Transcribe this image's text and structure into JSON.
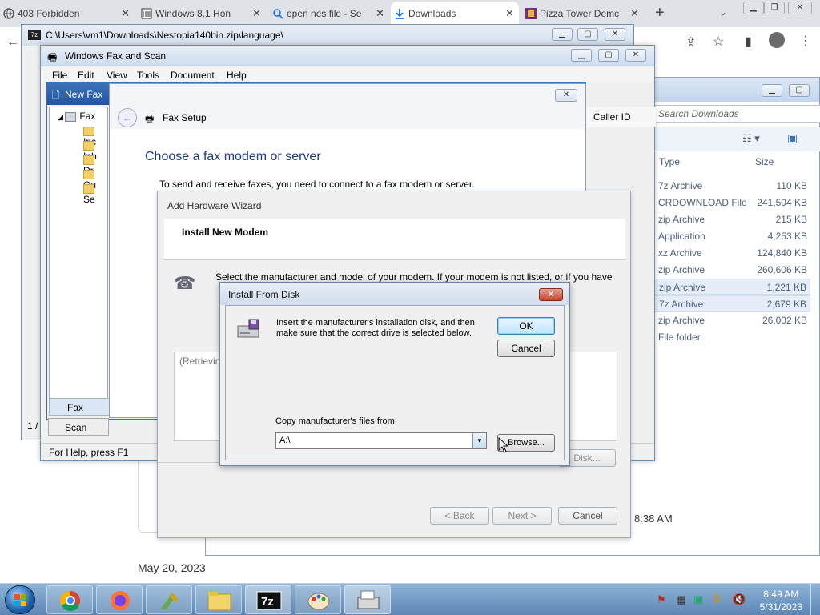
{
  "chrome": {
    "tabs": [
      {
        "label": "403 Forbidden"
      },
      {
        "label": "Windows 8.1 Hon"
      },
      {
        "label": "open nes file - Se"
      },
      {
        "label": "Downloads"
      },
      {
        "label": "Pizza Tower Demc"
      }
    ],
    "new_tab_label": "+"
  },
  "explorer": {
    "search_placeholder": "Search Downloads",
    "col_type": "Type",
    "col_size": "Size",
    "rows": [
      {
        "type": "7z Archive",
        "size": "110 KB"
      },
      {
        "type": "CRDOWNLOAD File",
        "size": "241,504 KB"
      },
      {
        "type": "zip Archive",
        "size": "215 KB"
      },
      {
        "type": "Application",
        "size": "4,253 KB"
      },
      {
        "type": "xz Archive",
        "size": "124,840 KB"
      },
      {
        "type": "zip Archive",
        "size": "260,606 KB"
      },
      {
        "type": "zip Archive",
        "size": "1,221 KB"
      },
      {
        "type": "7z Archive",
        "size": "2,679 KB"
      },
      {
        "type": "zip Archive",
        "size": "26,002 KB"
      },
      {
        "type": "File folder",
        "size": ""
      }
    ]
  },
  "background": {
    "date": "May 20, 2023",
    "time": "8:38 AM"
  },
  "win7z": {
    "title": "C:\\Users\\vm1\\Downloads\\Nestopia140bin.zip\\language\\"
  },
  "fax": {
    "title": "Windows Fax and Scan",
    "menu": [
      "File",
      "Edit",
      "View",
      "Tools",
      "Document",
      "Help"
    ],
    "nav_root": "Fax",
    "nav_children": [
      "Inc",
      "Inb",
      "Dr",
      "Ou",
      "Se"
    ],
    "bottom_tabs": [
      "Fax",
      "Scan"
    ],
    "status": "For Help, press F1",
    "caller_id": "Caller ID"
  },
  "newfax": {
    "title": "New Fax"
  },
  "setup": {
    "title": "Fax Setup",
    "heading": "Choose a fax modem or server",
    "desc": "To send and receive faxes, you need to connect to a fax modem or server."
  },
  "wizard": {
    "title": "Add Hardware Wizard",
    "header": "Install New Modem",
    "desc": "Select the manufacturer and model of your modem. If your modem is not listed, or if you have",
    "retrieving": "(Retrievin",
    "have_disk": "Disk...",
    "back": "< Back",
    "next": "Next >",
    "cancel": "Cancel"
  },
  "ifd": {
    "title": "Install From Disk",
    "message": "Insert the manufacturer's installation disk, and then make sure that the correct drive is selected below.",
    "ok": "OK",
    "cancel": "Cancel",
    "copy_label": "Copy manufacturer's files from:",
    "path": "A:\\",
    "browse": "Browse..."
  },
  "taskbar": {
    "time": "8:49 AM",
    "date": "5/31/2023",
    "apps": [
      "chrome",
      "firefox",
      "tools",
      "explorer",
      "7z",
      "paint",
      "fax"
    ]
  },
  "colors": {
    "taskbar": "#5d86b3",
    "title_active": "#2256a0",
    "accent_link": "#1e3c84"
  }
}
